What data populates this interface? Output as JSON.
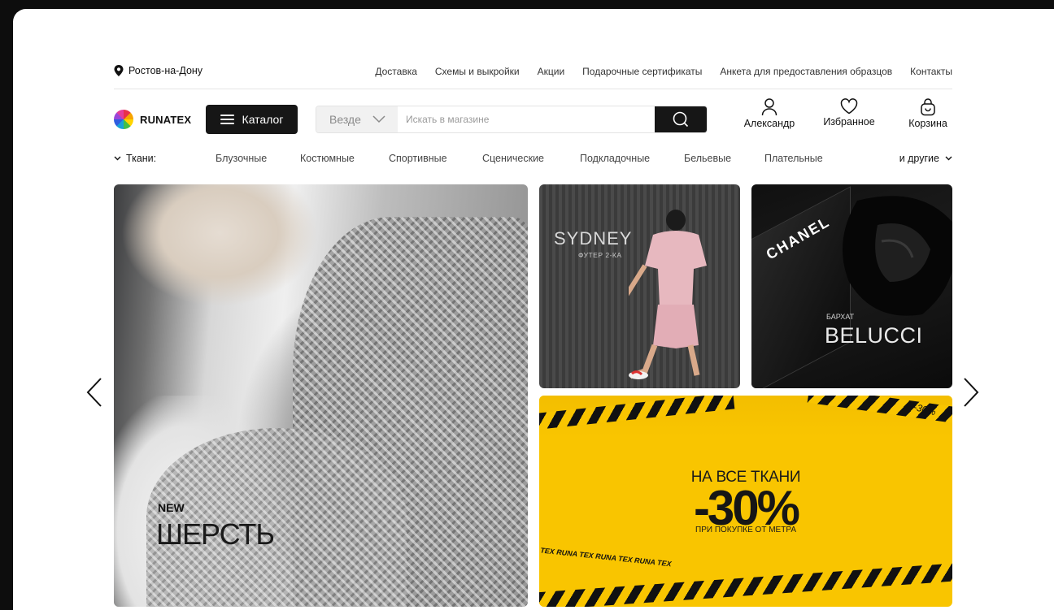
{
  "topbar": {
    "city": "Ростов-на-Дону",
    "links": [
      "Доставка",
      "Схемы и выкройки",
      "Акции",
      "Подарочные сертификаты",
      "Анкета для предоставления образцов",
      "Контакты"
    ]
  },
  "header": {
    "logo_text": "RUNATEX",
    "catalog_label": "Каталог",
    "search_scope": "Везде",
    "search_placeholder": "Искать в магазине",
    "user_label": "Александр",
    "favorites_label": "Избранное",
    "cart_label": "Корзина"
  },
  "categories": {
    "label": "Ткани:",
    "items": [
      "Блузочные",
      "Костюмные",
      "Спортивные",
      "Сценические",
      "Подкладочные",
      "Бельевые",
      "Плательные"
    ],
    "more_label": "и другие"
  },
  "banners": {
    "main": {
      "badge": "NEW",
      "title": "ШЕРСТЬ"
    },
    "sydney": {
      "title": "SYDNEY",
      "subtitle": "ФУТЕР 2-КА"
    },
    "belucci": {
      "brand": "CHANEL",
      "subtitle": "БАРХАТ",
      "title": "BELUCCI"
    },
    "sale": {
      "line1": "НА ВСЕ ТКАНИ",
      "discount": "-30%",
      "line3": "ПРИ ПОКУПКЕ ОТ МЕТРА",
      "corner": "-30%",
      "tape_text": "TEX   RUNA TEX   RUNA TEX   RUNA TEX"
    }
  },
  "colors": {
    "dark": "#161616",
    "sale_yellow": "#f9c500"
  }
}
